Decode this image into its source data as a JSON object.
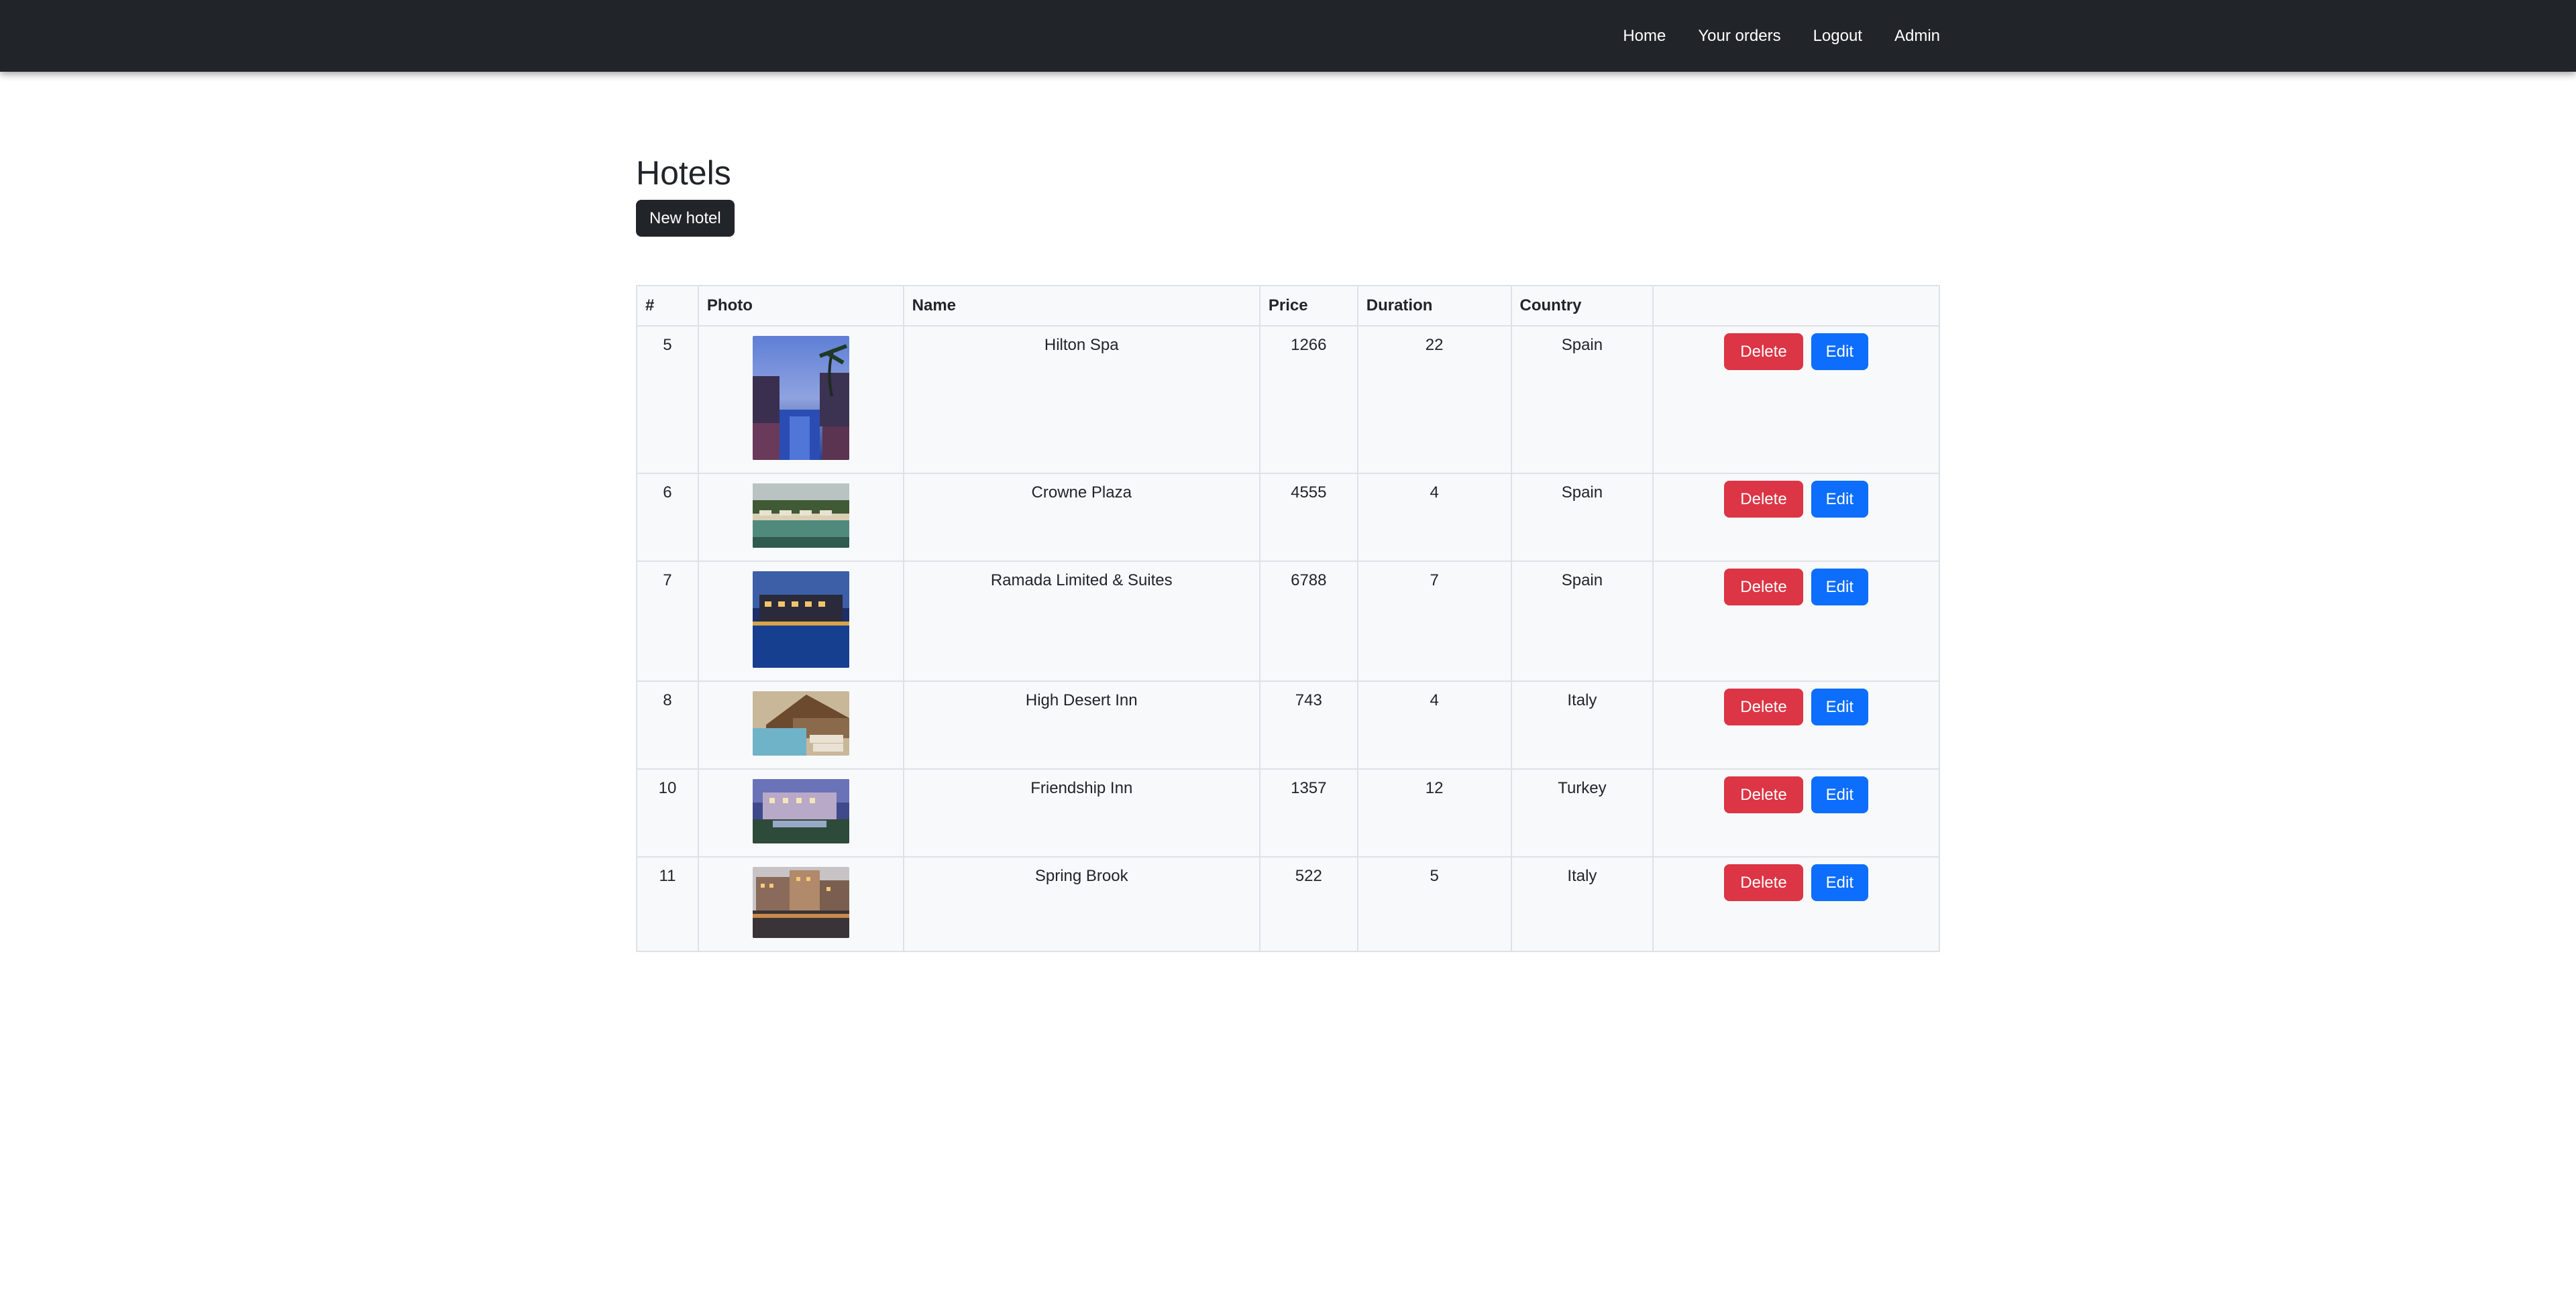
{
  "nav": {
    "links": [
      "Home",
      "Your orders",
      "Logout",
      "Admin"
    ]
  },
  "page": {
    "title": "Hotels",
    "new_button_label": "New hotel"
  },
  "table": {
    "headers": [
      "#",
      "Photo",
      "Name",
      "Price",
      "Duration",
      "Country",
      ""
    ],
    "delete_label": "Delete",
    "edit_label": "Edit",
    "rows": [
      {
        "id": "5",
        "name": "Hilton Spa",
        "price": "1266",
        "duration": "22",
        "country": "Spain",
        "photo_icon": "hotel-photo-pool-palms"
      },
      {
        "id": "6",
        "name": "Crowne Plaza",
        "price": "4555",
        "duration": "4",
        "country": "Spain",
        "photo_icon": "hotel-photo-pool-umbrellas"
      },
      {
        "id": "7",
        "name": "Ramada Limited & Suites",
        "price": "6788",
        "duration": "7",
        "country": "Spain",
        "photo_icon": "hotel-photo-pool-night"
      },
      {
        "id": "8",
        "name": "High Desert Inn",
        "price": "743",
        "duration": "4",
        "country": "Italy",
        "photo_icon": "hotel-photo-pool-loungers"
      },
      {
        "id": "10",
        "name": "Friendship Inn",
        "price": "1357",
        "duration": "12",
        "country": "Turkey",
        "photo_icon": "hotel-photo-building-dusk"
      },
      {
        "id": "11",
        "name": "Spring Brook",
        "price": "522",
        "duration": "5",
        "country": "Italy",
        "photo_icon": "hotel-photo-waterfront"
      }
    ]
  },
  "colors": {
    "navbar": "#212529",
    "delete": "#dc3545",
    "edit": "#0d6efd",
    "table_bg": "#f8f9fa"
  }
}
